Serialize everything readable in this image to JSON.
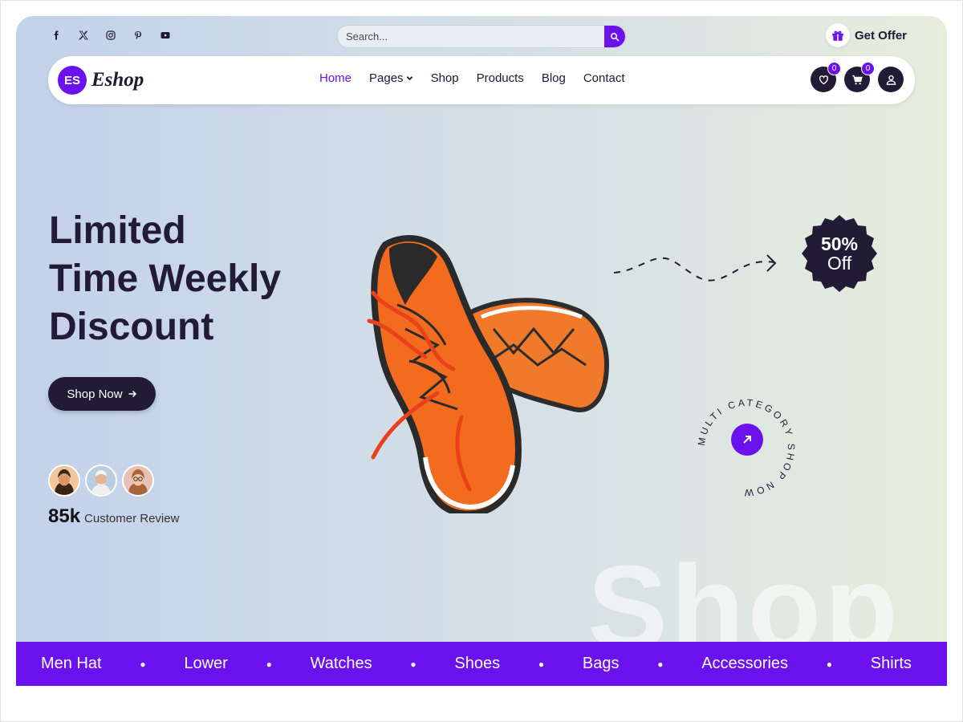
{
  "social": {
    "icons": [
      "facebook-icon",
      "x-icon",
      "instagram-icon",
      "pinterest-icon",
      "youtube-icon"
    ]
  },
  "search": {
    "placeholder": "Search..."
  },
  "offer": {
    "label": "Get Offer"
  },
  "logo": {
    "mark": "ES",
    "name": "Eshop"
  },
  "nav": {
    "items": [
      {
        "label": "Home"
      },
      {
        "label": "Pages"
      },
      {
        "label": "Shop"
      },
      {
        "label": "Products"
      },
      {
        "label": "Blog"
      },
      {
        "label": "Contact"
      }
    ],
    "wishlist_count": "0",
    "cart_count": "0"
  },
  "hero": {
    "title_line1": "Limited",
    "title_line2": "Time Weekly",
    "title_line3": "Discount",
    "cta": "Shop Now",
    "review_count": "85k",
    "review_label": "Customer Review",
    "sale_percent": "50%",
    "sale_off": "Off",
    "ring_text": "MULTI CATEGORY SHOP NOW",
    "watermark": "Shop"
  },
  "categories": [
    "Men Hat",
    "Lower",
    "Watches",
    "Shoes",
    "Bags",
    "Accessories",
    "Shirts"
  ],
  "colors": {
    "accent": "#6a11ee",
    "dark": "#221b36"
  }
}
